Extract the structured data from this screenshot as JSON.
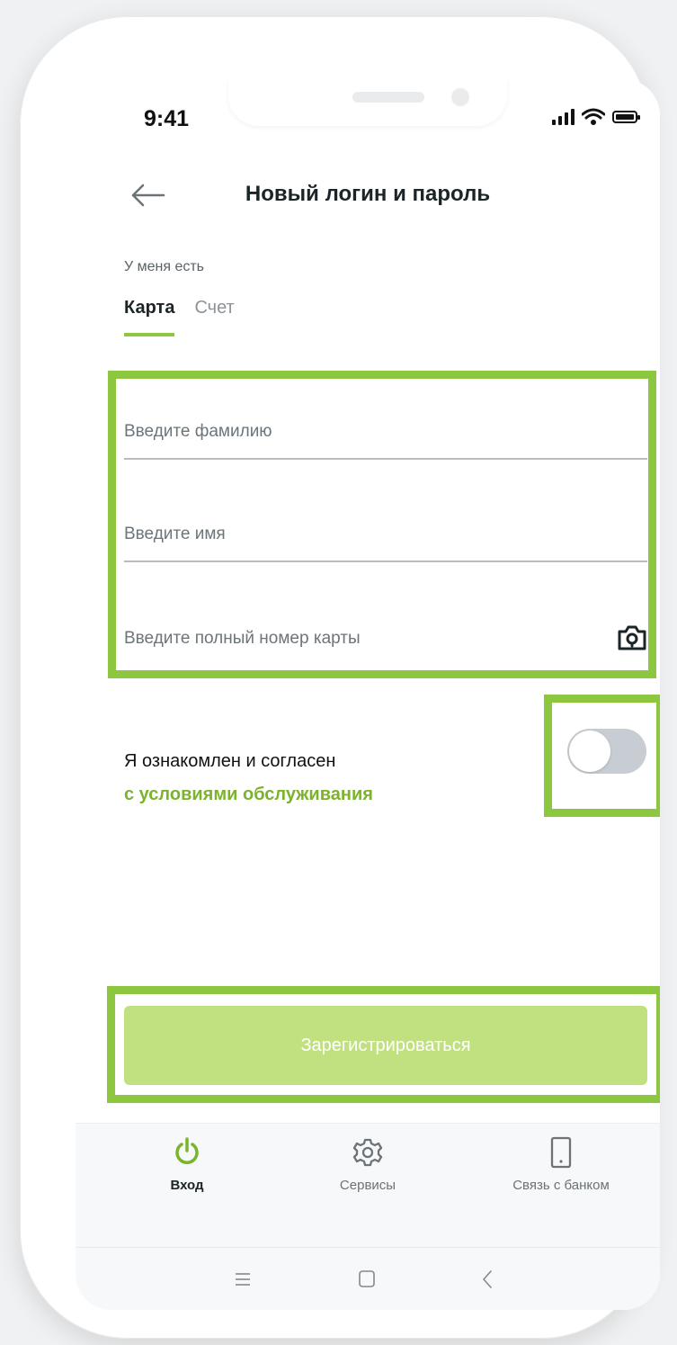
{
  "status_bar": {
    "time": "9:41"
  },
  "header": {
    "title": "Новый логин и пароль",
    "back_icon": "arrow-left-icon"
  },
  "form": {
    "has_label": "У меня есть",
    "tabs": [
      {
        "label": "Карта",
        "active": true
      },
      {
        "label": "Счет",
        "active": false
      }
    ],
    "fields": {
      "surname_placeholder": "Введите фамилию",
      "name_placeholder": "Введите имя",
      "card_placeholder": "Введите полный номер карты"
    },
    "agreement": {
      "text": "Я ознакомлен и согласен",
      "link": "с условиями обслуживания",
      "toggle_on": false
    },
    "register_button": "Зарегистрироваться"
  },
  "bottom_nav": {
    "items": [
      {
        "label": "Вход",
        "icon": "power-icon",
        "active": true
      },
      {
        "label": "Сервисы",
        "icon": "gear-icon",
        "active": false
      },
      {
        "label": "Связь с банком",
        "icon": "phone-icon",
        "active": false
      }
    ]
  },
  "colors": {
    "accent": "#8dc63f",
    "button_disabled": "#c1e080",
    "link": "#7cb32d"
  }
}
